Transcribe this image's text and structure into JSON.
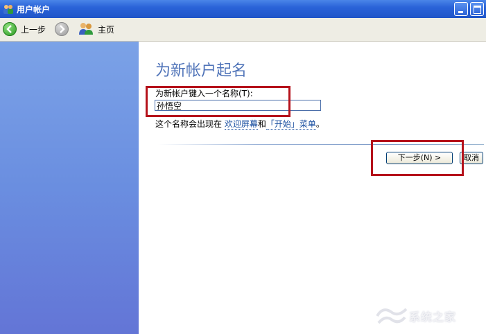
{
  "window": {
    "title": "用户帐户"
  },
  "toolbar": {
    "back_label": "上一步",
    "home_label": "主页"
  },
  "main": {
    "heading": "为新帐户起名",
    "field_label": "为新帐户键入一个名称(T):",
    "name_value": "孙悟空",
    "hint_prefix": "这个名称会出现在",
    "hint_link_welcome": "欢迎屏幕",
    "hint_and": "和",
    "hint_link_start": "「开始」菜单",
    "hint_suffix": "。",
    "next_button": "下一步(N) >",
    "cancel_button": "取消"
  },
  "watermark": {
    "text": "系统之家"
  },
  "colors": {
    "titlebar": "#2a63d8",
    "sidebar_top": "#7ba2e7",
    "sidebar_bottom": "#6375d6",
    "heading": "#4f73b8",
    "highlight": "#b5121b"
  }
}
